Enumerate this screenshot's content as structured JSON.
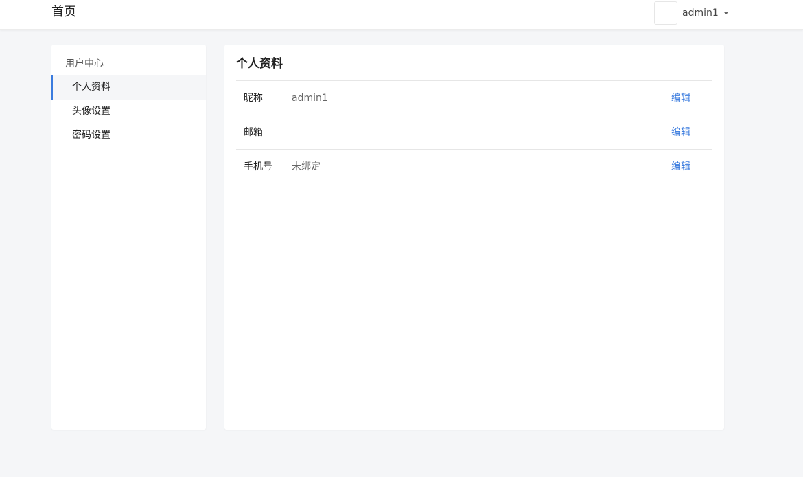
{
  "header": {
    "brand": "首页",
    "username": "admin1"
  },
  "sidebar": {
    "heading": "用户中心",
    "items": [
      {
        "label": "个人资料",
        "active": true
      },
      {
        "label": "头像设置",
        "active": false
      },
      {
        "label": "密码设置",
        "active": false
      }
    ]
  },
  "main": {
    "title": "个人资料",
    "rows": [
      {
        "label": "昵称",
        "value": "admin1",
        "action": "编辑"
      },
      {
        "label": "邮箱",
        "value": "",
        "action": "编辑"
      },
      {
        "label": "手机号",
        "value": "未绑定",
        "action": "编辑"
      }
    ]
  },
  "colors": {
    "accent": "#3a7bde",
    "background": "#f5f6f8"
  }
}
